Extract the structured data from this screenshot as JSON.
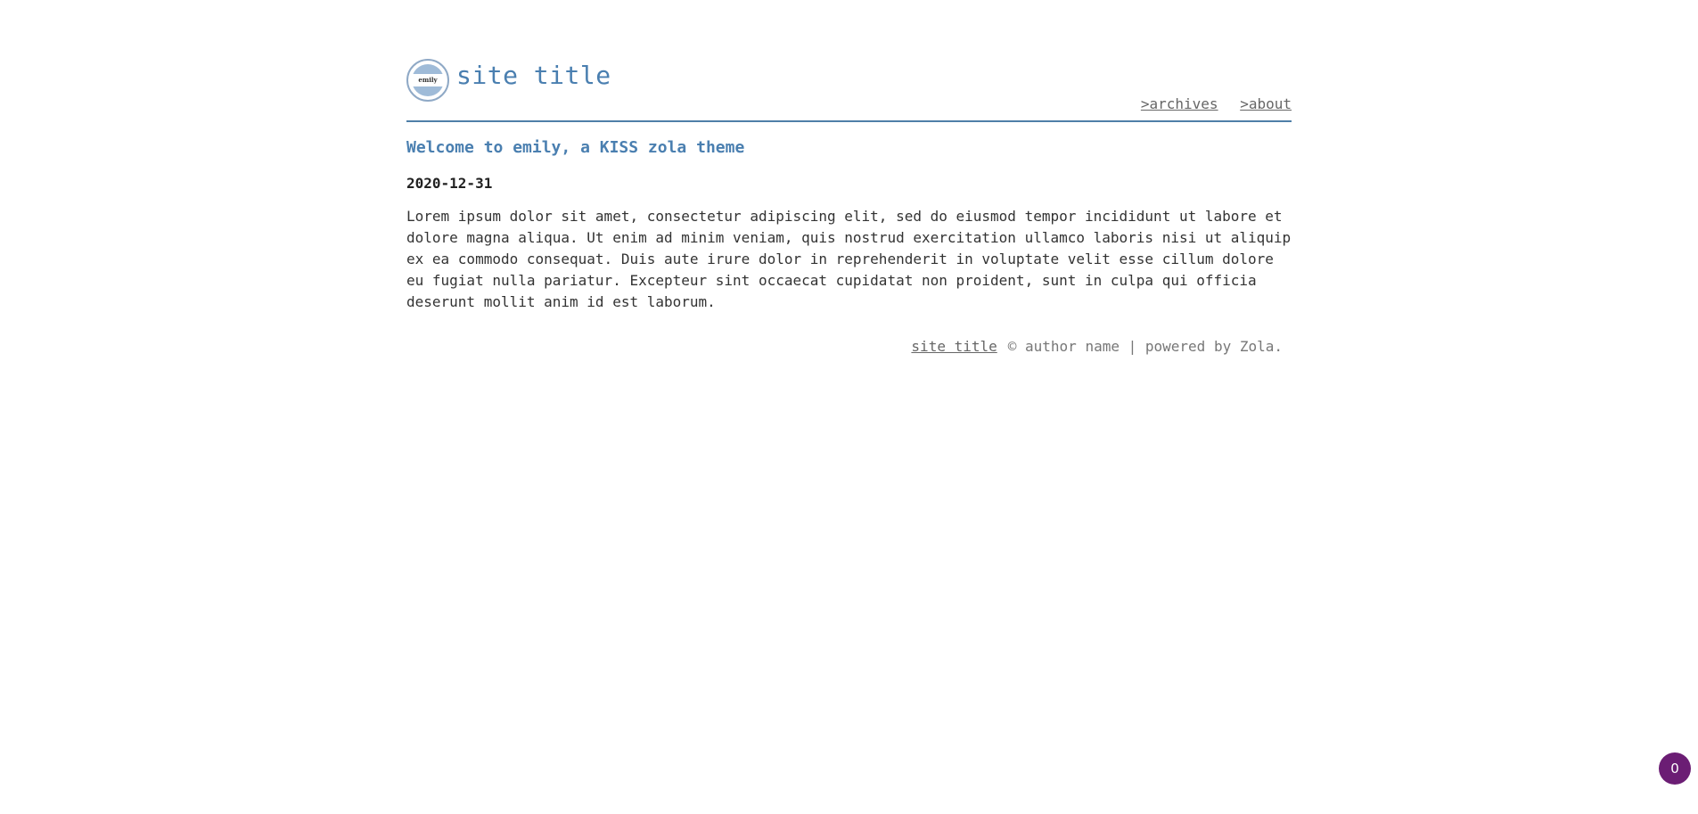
{
  "header": {
    "logo_text": "emily",
    "site_title": "site title",
    "nav": [
      {
        "label": ">archives"
      },
      {
        "label": ">about"
      }
    ]
  },
  "post": {
    "title": "Welcome to emily, a KISS zola theme",
    "date": "2020-12-31",
    "body": "Lorem ipsum dolor sit amet, consectetur adipiscing elit, sed do eiusmod tempor incididunt ut labore et dolore magna aliqua. Ut enim ad minim veniam, quis nostrud exercitation ullamco laboris nisi ut aliquip ex ea commodo consequat. Duis aute irure dolor in reprehenderit in voluptate velit esse cillum dolore eu fugiat nulla pariatur. Excepteur sint occaecat cupidatat non proident, sunt in culpa qui officia deserunt mollit anim id est laborum."
  },
  "footer": {
    "site_link": "site title",
    "text": "© author name | powered by Zola."
  },
  "badge": {
    "count": "0"
  },
  "colors": {
    "accent": "#4a7fb0",
    "header_rule": "#4f7fa8",
    "badge_bg": "#6b1d74"
  }
}
